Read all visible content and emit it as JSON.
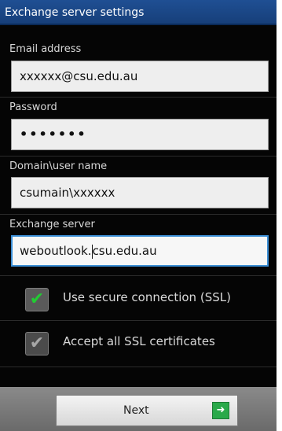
{
  "window": {
    "title": "Exchange server settings"
  },
  "fields": {
    "email": {
      "label": "Email address",
      "value": "xxxxxx@csu.edu.au"
    },
    "password": {
      "label": "Password",
      "value": "•••••••"
    },
    "domain_user": {
      "label": "Domain\\user name",
      "value": "csumain\\xxxxxx"
    },
    "exchange_server": {
      "label": "Exchange server",
      "value_before_caret": "weboutlook.",
      "value_after_caret": "csu.edu.au"
    }
  },
  "options": {
    "ssl": {
      "label": "Use secure connection (SSL)",
      "checked": true,
      "check_glyph": "✔"
    },
    "accept_all": {
      "label": "Accept all SSL certificates",
      "checked": true,
      "check_glyph": "✔"
    }
  },
  "footer": {
    "next_label": "Next",
    "next_icon": "➜"
  },
  "colors": {
    "title_bg": "#1f4f93",
    "check_green": "#22cc33",
    "focus_border": "#3c8fd6"
  }
}
